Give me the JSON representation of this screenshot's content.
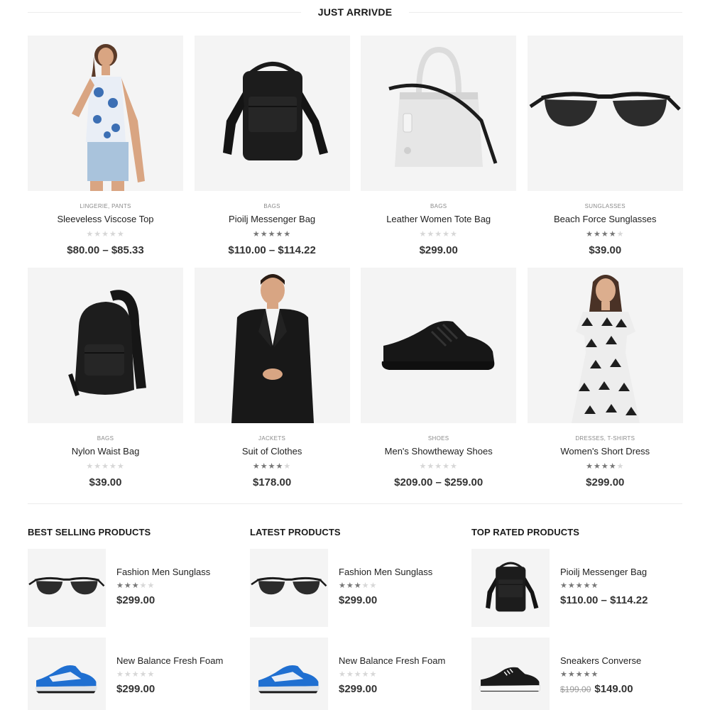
{
  "section_title": "JUST ARRIVDE",
  "products": [
    {
      "category": "LINGERIE, PANTS",
      "name": "Sleeveless Viscose Top",
      "rating": 0,
      "price": "$80.00 – $85.33",
      "icon": "woman-tank-top"
    },
    {
      "category": "BAGS",
      "name": "Pioilj Messenger Bag",
      "rating": 5,
      "price": "$110.00 – $114.22",
      "icon": "messenger-bag"
    },
    {
      "category": "BAGS",
      "name": "Leather Women Tote Bag",
      "rating": 0,
      "price": "$299.00",
      "icon": "tote-bag"
    },
    {
      "category": "SUNGLASSES",
      "name": "Beach Force Sunglasses",
      "rating": 4,
      "price": "$39.00",
      "icon": "sunglasses"
    },
    {
      "category": "BAGS",
      "name": "Nylon Waist Bag",
      "rating": 0,
      "price": "$39.00",
      "icon": "sling-bag"
    },
    {
      "category": "JACKETS",
      "name": "Suit of Clothes",
      "rating": 4,
      "price": "$178.00",
      "icon": "man-suit"
    },
    {
      "category": "SHOES",
      "name": "Men's Showtheway Shoes",
      "rating": 0,
      "price": "$209.00 – $259.00",
      "icon": "black-sneaker"
    },
    {
      "category": "DRESSES, T-SHIRTS",
      "name": "Women's Short Dress",
      "rating": 4,
      "price": "$299.00",
      "icon": "woman-dress"
    }
  ],
  "columns": [
    {
      "title": "BEST SELLING PRODUCTS",
      "items": [
        {
          "name": "Fashion Men Sunglass",
          "rating": 3,
          "price": "$299.00",
          "old_price": "",
          "icon": "sunglasses"
        },
        {
          "name": "New Balance Fresh Foam",
          "rating": 0,
          "price": "$299.00",
          "old_price": "",
          "icon": "blue-sneaker"
        }
      ]
    },
    {
      "title": "LATEST PRODUCTS",
      "items": [
        {
          "name": "Fashion Men Sunglass",
          "rating": 3,
          "price": "$299.00",
          "old_price": "",
          "icon": "sunglasses"
        },
        {
          "name": "New Balance Fresh Foam",
          "rating": 0,
          "price": "$299.00",
          "old_price": "",
          "icon": "blue-sneaker"
        }
      ]
    },
    {
      "title": "TOP RATED PRODUCTS",
      "items": [
        {
          "name": "Pioilj Messenger Bag",
          "rating": 5,
          "price": "$110.00 – $114.22",
          "old_price": "",
          "icon": "messenger-bag"
        },
        {
          "name": "Sneakers Converse",
          "rating": 5,
          "price": "$149.00",
          "old_price": "$199.00",
          "icon": "canvas-sneaker"
        }
      ]
    }
  ]
}
